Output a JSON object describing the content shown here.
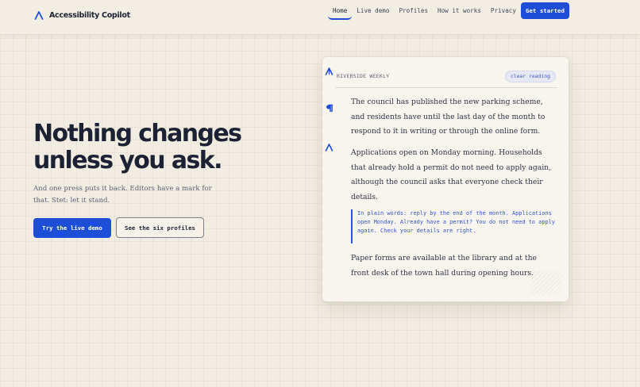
{
  "header": {
    "brand": "Accessibility Copilot",
    "nav": [
      "Home",
      "Live demo",
      "Profiles",
      "How it works",
      "Privacy"
    ],
    "cta": "Get started"
  },
  "hero": {
    "headline_line1": "Nothing changes",
    "headline_line2": "unless you ask.",
    "subtext": "And one press puts it back. Editors have a mark for that. Stet: let it stand.",
    "primary_button": "Try the live demo",
    "secondary_button": "See the six profiles"
  },
  "card": {
    "publication": "RIVERSIDE WEEKLY",
    "badge": "clear reading",
    "paragraphs": [
      "The council has published the new parking scheme, and residents have until the last day of the month to respond to it in writing or through the online form.",
      "Applications open on Monday morning. Households that already hold a permit do not need to apply again, although the council asks that everyone check their details.",
      "Paper forms are available at the library and at the front desk of the town hall during opening hours."
    ],
    "plain_words": "In plain words: reply by the end of the month. Applications open Monday. Already have a permit? You do not need to apply again. Check your details are right."
  },
  "colors": {
    "accent": "#1d4ed8",
    "background": "#f2ede2",
    "ink": "#1c2233"
  },
  "icons": [
    "brand-logo-icon",
    "stet-caret-icon",
    "pilcrow-icon",
    "caret-mark-icon"
  ]
}
